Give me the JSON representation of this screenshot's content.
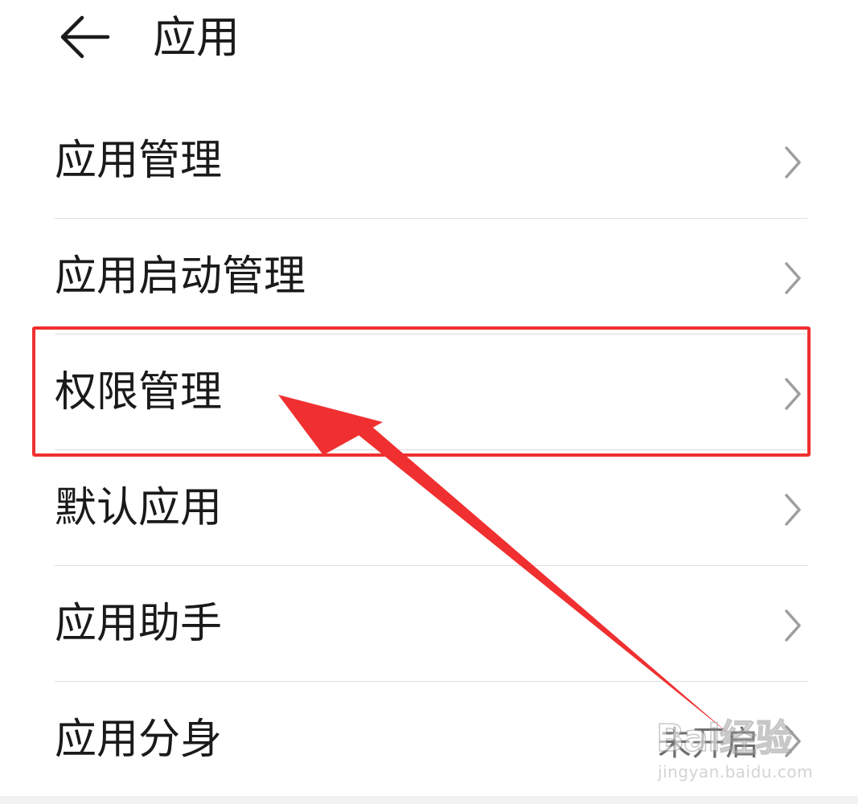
{
  "header": {
    "back_icon": "arrow-left-icon",
    "title": "应用"
  },
  "menu": {
    "items": [
      {
        "label": "应用管理",
        "value": ""
      },
      {
        "label": "应用启动管理",
        "value": ""
      },
      {
        "label": "权限管理",
        "value": ""
      },
      {
        "label": "默认应用",
        "value": ""
      },
      {
        "label": "应用助手",
        "value": ""
      },
      {
        "label": "应用分身",
        "value": "未开启"
      }
    ]
  },
  "annotation": {
    "highlight_color": "#f03030",
    "highlighted_item": "权限管理"
  },
  "watermark": {
    "logo": "Bai经验",
    "url": "jingyan.baidu.com"
  },
  "colors": {
    "text": "#1a1a1a",
    "secondary_text": "#6f6f6f",
    "divider": "#dcdcdc",
    "chevron": "#9e9e9e",
    "accent_red": "#f03030"
  }
}
